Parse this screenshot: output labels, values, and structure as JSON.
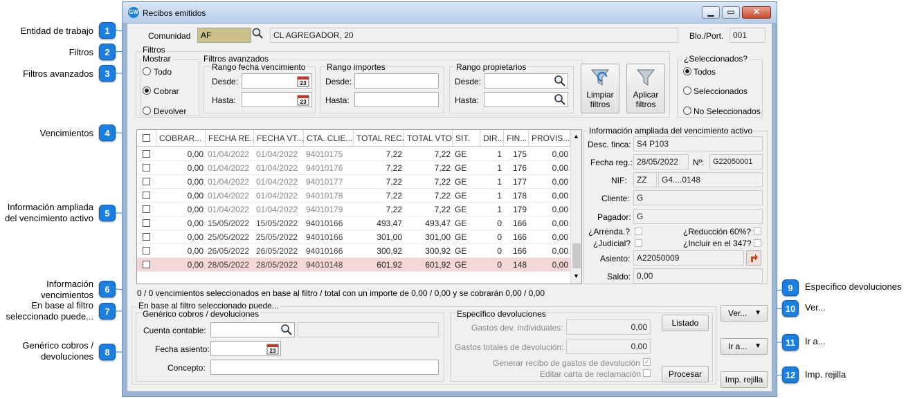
{
  "callouts": [
    {
      "num": "1",
      "label": "Entidad de trabajo"
    },
    {
      "num": "2",
      "label": "Filtros"
    },
    {
      "num": "3",
      "label": "Filtros avanzados"
    },
    {
      "num": "4",
      "label": "Vencimientos"
    },
    {
      "num": "5",
      "label": "Información ampliada\ndel vencimiento activo"
    },
    {
      "num": "6",
      "label": "Información\nvencimientos"
    },
    {
      "num": "7",
      "label": "En base al filtro\nseleccionado puede..."
    },
    {
      "num": "8",
      "label": "Genérico cobros /\ndevoluciones"
    },
    {
      "num": "9",
      "label": "Específico devoluciones"
    },
    {
      "num": "10",
      "label": "Ver..."
    },
    {
      "num": "11",
      "label": "Ir a..."
    },
    {
      "num": "12",
      "label": "Imp. rejilla"
    }
  ],
  "window": {
    "title": "Recibos emitidos"
  },
  "entity": {
    "label": "Comunidad",
    "code": "AF",
    "name": "CL AGREGADOR, 20",
    "blo_label": "Blo./Port.",
    "blo_value": "001"
  },
  "filters": {
    "title": "Filtros",
    "show_title": "Mostrar",
    "show_options": [
      {
        "label": "Todo",
        "selected": false
      },
      {
        "label": "Cobrar",
        "selected": true
      },
      {
        "label": "Devolver",
        "selected": false
      }
    ],
    "advanced_title": "Filtros avanzados",
    "date_range_title": "Rango fecha vencimiento",
    "amount_range_title": "Rango importes",
    "owner_range_title": "Rango propietarios",
    "from_label": "Desde:",
    "to_label": "Hasta:",
    "clear_button": "Limpiar\nfiltros",
    "apply_button": "Aplicar\nfiltros",
    "selected_title": "¿Seleccionados?",
    "selected_options": [
      {
        "label": "Todos",
        "selected": true
      },
      {
        "label": "Seleccionados",
        "selected": false
      },
      {
        "label": "No Seleccionados",
        "selected": false
      }
    ]
  },
  "grid": {
    "columns": [
      "COBRAR...",
      "FECHA RE...",
      "FECHA VT...",
      "CTA. CLIE...",
      "TOTAL REC.",
      "TOTAL VTO.",
      "SIT.",
      "DIR...",
      "FIN...",
      "PROVIS..."
    ],
    "rows": [
      {
        "cobrar": "0,00",
        "fecha_re": "01/04/2022",
        "fecha_vt": "01/04/2022",
        "cta": "94010175",
        "total_rec": "7,22",
        "total_vto": "7,22",
        "sit": "GE",
        "dir": "1",
        "fin": "175",
        "provis": "0,00",
        "gray": true,
        "sel": false
      },
      {
        "cobrar": "0,00",
        "fecha_re": "01/04/2022",
        "fecha_vt": "01/04/2022",
        "cta": "94010176",
        "total_rec": "7,22",
        "total_vto": "7,22",
        "sit": "GE",
        "dir": "1",
        "fin": "176",
        "provis": "0,00",
        "gray": true,
        "sel": false
      },
      {
        "cobrar": "0,00",
        "fecha_re": "01/04/2022",
        "fecha_vt": "01/04/2022",
        "cta": "94010177",
        "total_rec": "7,22",
        "total_vto": "7,22",
        "sit": "GE",
        "dir": "1",
        "fin": "177",
        "provis": "0,00",
        "gray": true,
        "sel": false
      },
      {
        "cobrar": "0,00",
        "fecha_re": "01/04/2022",
        "fecha_vt": "01/04/2022",
        "cta": "94010178",
        "total_rec": "7,22",
        "total_vto": "7,22",
        "sit": "GE",
        "dir": "1",
        "fin": "178",
        "provis": "0,00",
        "gray": true,
        "sel": false
      },
      {
        "cobrar": "0,00",
        "fecha_re": "01/04/2022",
        "fecha_vt": "01/04/2022",
        "cta": "94010179",
        "total_rec": "7,22",
        "total_vto": "7,22",
        "sit": "GE",
        "dir": "1",
        "fin": "179",
        "provis": "0,00",
        "gray": true,
        "sel": false
      },
      {
        "cobrar": "0,00",
        "fecha_re": "15/05/2022",
        "fecha_vt": "15/05/2022",
        "cta": "94010166",
        "total_rec": "493,47",
        "total_vto": "493,47",
        "sit": "GE",
        "dir": "0",
        "fin": "166",
        "provis": "0,00",
        "gray": false,
        "sel": false
      },
      {
        "cobrar": "0,00",
        "fecha_re": "25/05/2022",
        "fecha_vt": "25/05/2022",
        "cta": "94010166",
        "total_rec": "301,00",
        "total_vto": "301,00",
        "sit": "GE",
        "dir": "0",
        "fin": "166",
        "provis": "0,00",
        "gray": false,
        "sel": false
      },
      {
        "cobrar": "0,00",
        "fecha_re": "26/05/2022",
        "fecha_vt": "26/05/2022",
        "cta": "94010166",
        "total_rec": "300,92",
        "total_vto": "300,92",
        "sit": "GE",
        "dir": "0",
        "fin": "166",
        "provis": "0,00",
        "gray": false,
        "sel": false
      },
      {
        "cobrar": "0,00",
        "fecha_re": "28/05/2022",
        "fecha_vt": "28/05/2022",
        "cta": "94010148",
        "total_rec": "601,92",
        "total_vto": "601,92",
        "sit": "GE",
        "dir": "0",
        "fin": "148",
        "provis": "0,00",
        "gray": false,
        "sel": true
      }
    ]
  },
  "info": {
    "title": "Información ampliada del vencimiento activo",
    "desc_finca_label": "Desc. finca:",
    "desc_finca": "S4 P103",
    "fecha_reg_label": "Fecha reg.:",
    "fecha_reg": "28/05/2022",
    "num_label": "Nº:",
    "num": "G22050001",
    "nif_label": "NIF:",
    "nif_prefix": "ZZ",
    "nif": "G4....0148",
    "cliente_label": "Cliente:",
    "cliente": "G",
    "pagador_label": "Pagador:",
    "pagador": "G",
    "arrenda_label": "¿Arrenda.?",
    "reduccion_label": "¿Reducción 60%?",
    "judicial_label": "¿Judicial?",
    "incluir_label": "¿Incluir en el 347?",
    "asiento_label": "Asiento:",
    "asiento": "A22050009",
    "saldo_label": "Saldo:",
    "saldo": "0,00"
  },
  "status_line": "0 / 0 vencimientos seleccionados en base al filtro / total con un importe de 0,00 / 0,00 y se cobrarán 0,00 / 0,00",
  "actions": {
    "title": "En base al filtro seleccionado puede...",
    "generic_title": "Genérico cobros / devoluciones",
    "cuenta_label": "Cuenta contable:",
    "fecha_asiento_label": "Fecha asiento:",
    "concepto_label": "Concepto:",
    "specific_title": "Específico devoluciones",
    "gastos_ind_label": "Gastos dev. individuales:",
    "gastos_ind": "0,00",
    "gastos_tot_label": "Gastos totales de devolución:",
    "gastos_tot": "0,00",
    "generar_label": "Generar recibo de gastos de devolución",
    "editar_label": "Editar carta de reclamación",
    "listado_button": "Listado",
    "procesar_button": "Procesar",
    "ver_button": "Ver...",
    "ira_button": "Ir a...",
    "imp_button": "Imp. rejilla"
  },
  "colors": {
    "accent": "#1a7fe0",
    "selected_row": "#f6d7d7",
    "highlight_input": "#c9c08a"
  }
}
